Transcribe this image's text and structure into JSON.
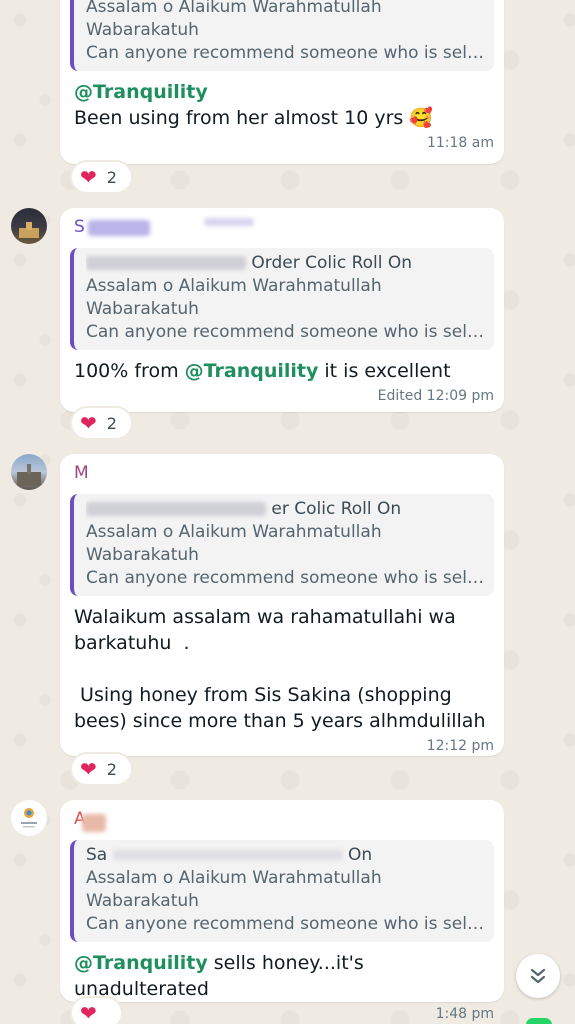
{
  "messages": [
    {
      "sender": "",
      "quote": {
        "author": "",
        "lines": [
          "Assalam o Alaikum Warahmatullah",
          "Wabarakatuh",
          "Can anyone recommend someone who is sellin..."
        ]
      },
      "mention": "@Tranquility",
      "text": "Been using from her almost 10 yrs",
      "emoji": "🥰",
      "time": "11:18 am",
      "reaction": {
        "emoji": "❤",
        "count": "2"
      }
    },
    {
      "sender": "S",
      "quote": {
        "author": "Order Colic Roll On",
        "lines": [
          "Assalam o Alaikum Warahmatullah",
          "Wabarakatuh",
          "Can anyone recommend someone who is sellin..."
        ]
      },
      "text_pre": "100% from ",
      "mention": "@Tranquility",
      "text_post": " it is excellent",
      "time": "Edited 12:09 pm",
      "reaction": {
        "emoji": "❤",
        "count": "2"
      }
    },
    {
      "sender": "M",
      "quote": {
        "author": "er Colic Roll On",
        "lines": [
          "Assalam o Alaikum Warahmatullah",
          "Wabarakatuh",
          "Can anyone recommend someone who is sellin..."
        ]
      },
      "text": "Walaikum assalam wa rahamatullahi wa\nbarkatuhu  .\n\n Using honey from Sis Sakina (shopping\nbees) since more than 5 years alhmdulillah",
      "time": "12:12 pm",
      "reaction": {
        "emoji": "❤",
        "count": "2"
      }
    },
    {
      "sender": "A",
      "quote": {
        "author": "Sa",
        "author_tail": "On",
        "lines": [
          "Assalam o Alaikum Warahmatullah",
          "Wabarakatuh",
          "Can anyone recommend someone who is sellin..."
        ]
      },
      "mention": "@Tranquility",
      "text_post": " sells honey...it's unadulterated",
      "time": "1:48 pm",
      "reaction": {
        "emoji": "❤",
        "count": ""
      }
    }
  ],
  "colors": {
    "mention": "#1f8f5f",
    "quote_border": "#6c4ec4",
    "sender_s": "#6c4ec4",
    "sender_m": "#a0457a",
    "sender_a": "#d9534f"
  },
  "icons": {
    "scroll_down": "chevron-double-down-icon"
  }
}
